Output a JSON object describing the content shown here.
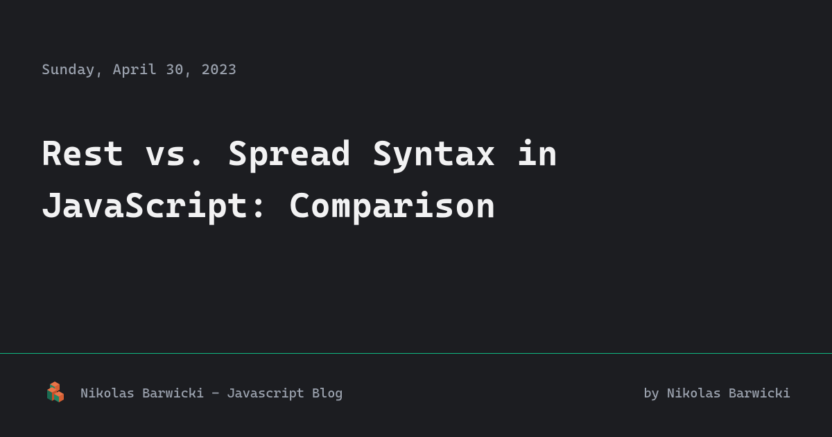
{
  "date": "Sunday, April 30, 2023",
  "title": "Rest vs. Spread Syntax in JavaScript: Comparison",
  "footer": {
    "site_name": "Nikolas Barwicki - Javascript Blog",
    "author": "by Nikolas Barwicki"
  },
  "colors": {
    "background": "#1c1d21",
    "text_primary": "#f2f2f3",
    "text_secondary": "#9ca3af",
    "accent": "#10b981",
    "logo_orange": "#e97448",
    "logo_green": "#238666"
  }
}
